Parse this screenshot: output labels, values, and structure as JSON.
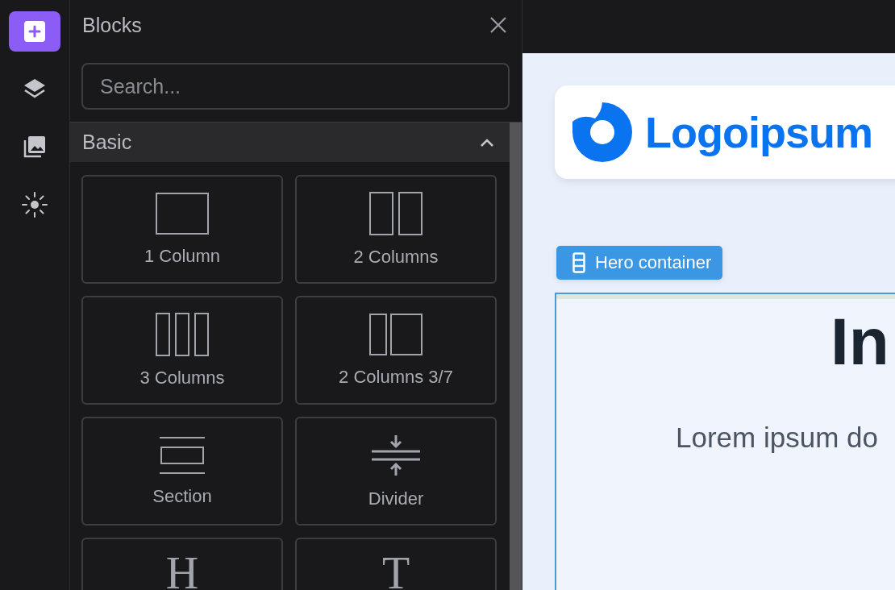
{
  "rail": [
    {
      "kind": "add",
      "selected": true
    },
    {
      "kind": "layers",
      "selected": false
    },
    {
      "kind": "assets",
      "selected": false
    },
    {
      "kind": "theme",
      "selected": false
    }
  ],
  "panel": {
    "title": "Blocks",
    "search": {
      "placeholder": "Search..."
    },
    "section": {
      "title": "Basic",
      "expanded": true
    },
    "blocks": [
      {
        "kind": "one-column",
        "label": "1 Column"
      },
      {
        "kind": "two-columns",
        "label": "2 Columns"
      },
      {
        "kind": "three-columns",
        "label": "3 Columns"
      },
      {
        "kind": "columns-3-7",
        "label": "2 Columns 3/7"
      },
      {
        "kind": "section",
        "label": "Section"
      },
      {
        "kind": "divider",
        "label": "Divider"
      },
      {
        "kind": "glyph",
        "glyph": "H"
      },
      {
        "kind": "glyph",
        "glyph": "T"
      }
    ]
  },
  "canvas": {
    "logo": "Logoipsum",
    "badge": "Hero container",
    "heading": "In",
    "text": "Lorem ipsum do"
  }
}
